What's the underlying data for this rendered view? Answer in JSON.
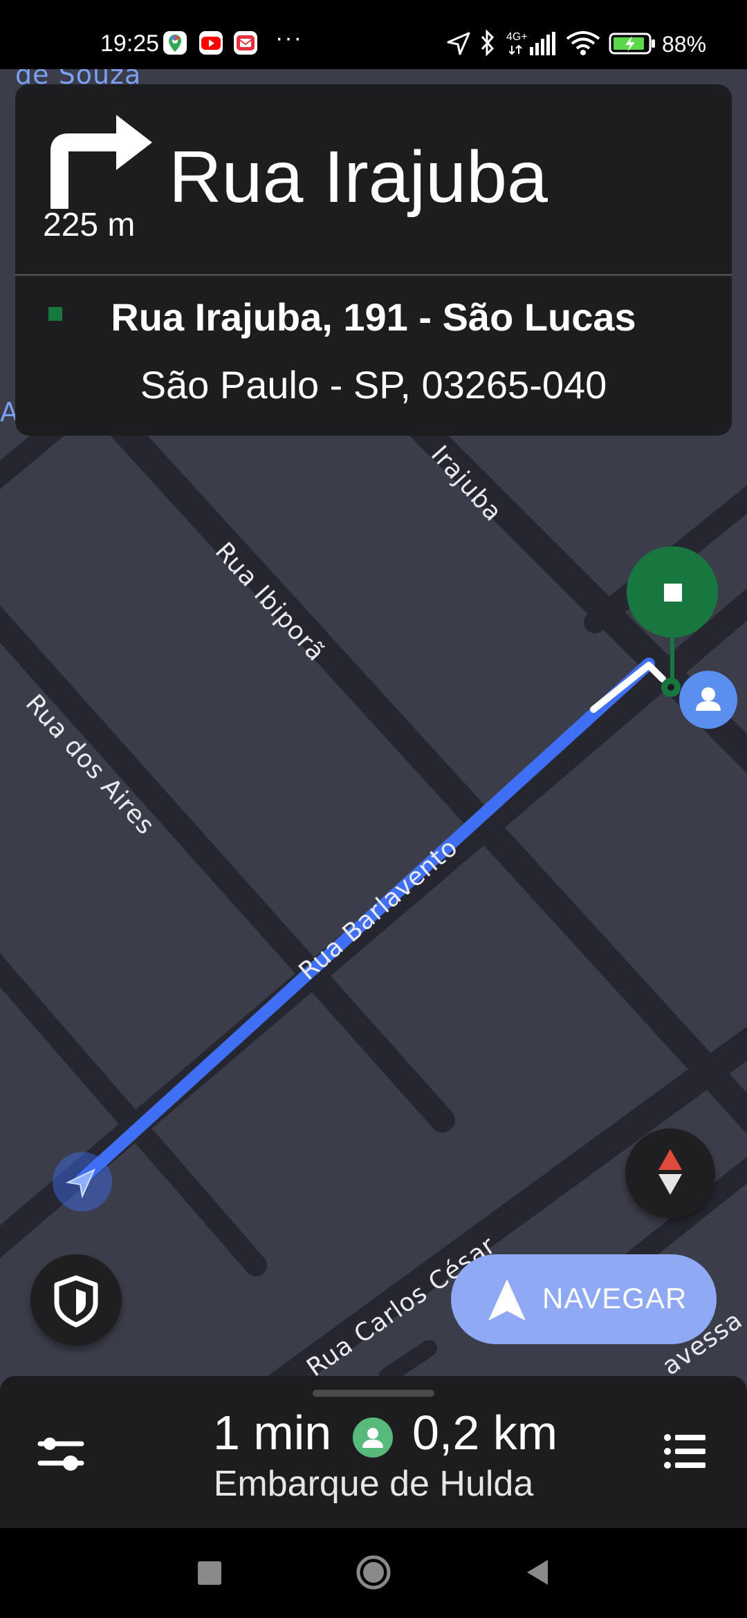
{
  "status_bar": {
    "time": "19:25",
    "network": "4G+",
    "battery": "88%",
    "overflow": "···"
  },
  "map": {
    "labels": {
      "top_left": "de Souza",
      "irajuba": "Irajuba",
      "ibipora": "Rua Ibiporã",
      "dos_aires": "Rua dos Aires",
      "barlavento": "Rua Barlavento",
      "carlos_cesar": "Rua Carlos César",
      "travessa": "avessa",
      "edge_a": "A"
    }
  },
  "direction": {
    "distance": "225 m",
    "street": "Rua Irajuba",
    "address_line1": "Rua Irajuba, 191 - São Lucas",
    "address_line2": "São Paulo - SP, 03265-040"
  },
  "navigate_button": {
    "label": "NAVEGAR"
  },
  "trip": {
    "eta_time": "1 min",
    "eta_distance": "0,2 km",
    "subtitle": "Embarque de Hulda"
  },
  "colors": {
    "route": "#3f6ff5",
    "destination": "#17773f",
    "nav_button": "#8fa9f5",
    "map_bg": "#3c3d4a",
    "road": "#252630"
  }
}
